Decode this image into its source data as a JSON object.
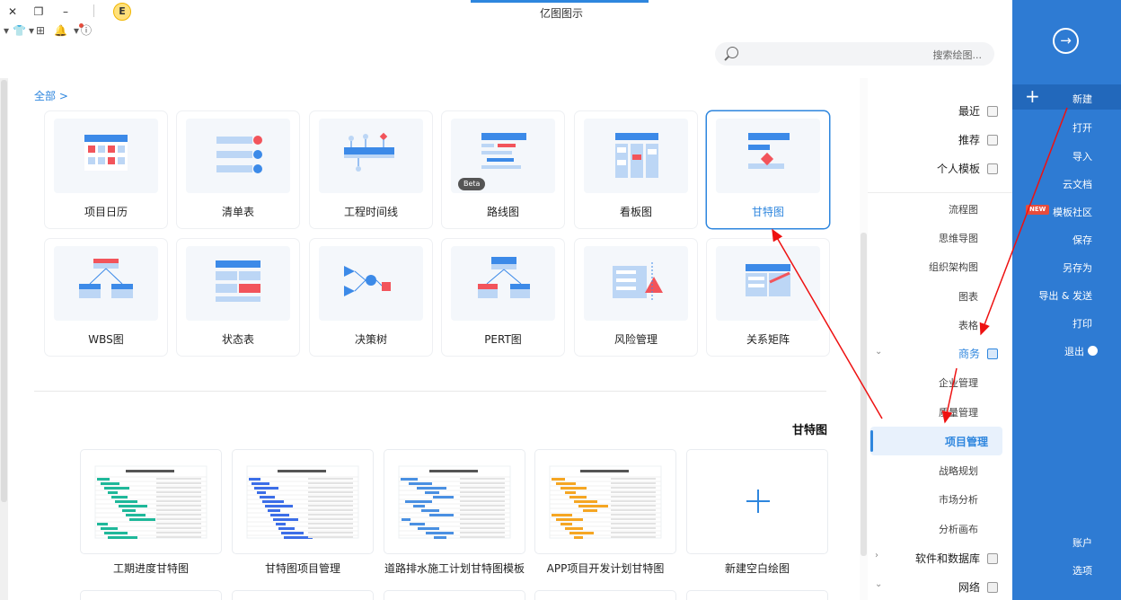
{
  "app": {
    "title": "亿图图示"
  },
  "toolbar": {
    "badge": "E",
    "search_placeholder": "搜索绘图..."
  },
  "main": {
    "back_label": "全部 >",
    "templates_row1": [
      {
        "label": "甘特图",
        "selected": true
      },
      {
        "label": "看板图"
      },
      {
        "label": "路线图",
        "beta": "Beta"
      },
      {
        "label": "工程时间线"
      },
      {
        "label": "清单表"
      },
      {
        "label": "项目日历"
      }
    ],
    "templates_row2": [
      {
        "label": "关系矩阵"
      },
      {
        "label": "风险管理"
      },
      {
        "label": "PERT图"
      },
      {
        "label": "决策树"
      },
      {
        "label": "状态表"
      },
      {
        "label": "WBS图"
      }
    ],
    "section_title": "甘特图",
    "gallery": [
      {
        "label": "新建空白绘图",
        "icon": "plus-icon"
      },
      {
        "label": "APP项目开发计划甘特图"
      },
      {
        "label": "道路排水施工计划甘特图模板"
      },
      {
        "label": "甘特图项目管理"
      },
      {
        "label": "工期进度甘特图"
      }
    ]
  },
  "categories": {
    "top": [
      {
        "label": "最近"
      },
      {
        "label": "推荐"
      },
      {
        "label": "个人模板"
      }
    ],
    "sub_items": [
      "流程图",
      "思维导图",
      "组织架构图",
      "图表",
      "表格"
    ],
    "business_group": "商务",
    "business_items": [
      "企业管理",
      "质量管理"
    ],
    "active_item": "项目管理",
    "business_items_after": [
      "战略规划",
      "市场分析",
      "分析画布"
    ],
    "group_software": "软件和数据库",
    "group_network": "网络"
  },
  "nav": {
    "new": "新建",
    "items": [
      "打开",
      "导入",
      "云文档",
      "模板社区",
      "保存",
      "另存为",
      "导出 & 发送",
      "打印",
      "退出"
    ],
    "new_tag": "NEW",
    "bottom": [
      "账户",
      "选项"
    ]
  }
}
